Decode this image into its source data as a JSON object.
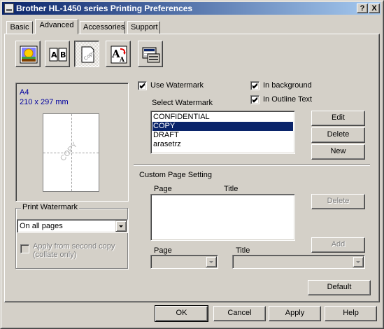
{
  "window": {
    "title": "Brother HL-1450 series Printing Preferences",
    "help_button": "?",
    "close_button": "X"
  },
  "tabs": [
    {
      "label": "Basic",
      "active": false
    },
    {
      "label": "Advanced",
      "active": true
    },
    {
      "label": "Accessories",
      "active": false
    },
    {
      "label": "Support",
      "active": false
    }
  ],
  "toolbar": {
    "icons": [
      "print-quality-icon",
      "duplex-icon",
      "watermark-icon",
      "page-setting-icon",
      "device-options-icon"
    ],
    "pressed_index": 2
  },
  "preview": {
    "paper_size": "A4",
    "dimensions": "210 x 297 mm",
    "watermark_text": "COPY"
  },
  "print_watermark": {
    "group_label": "Print Watermark",
    "selected": "On all pages",
    "apply_from_second": "Apply from second copy\n(collate only)"
  },
  "watermark": {
    "use_watermark_label": "Use Watermark",
    "use_watermark_checked": true,
    "in_background_label": "In background",
    "in_background_checked": true,
    "in_outline_label": "In Outline Text",
    "in_outline_checked": true,
    "select_label": "Select Watermark",
    "items": [
      "CONFIDENTIAL",
      "COPY",
      "DRAFT",
      "arasetrz"
    ],
    "selected_index": 1,
    "edit_button": "Edit",
    "delete_button": "Delete",
    "new_button": "New"
  },
  "custom_page": {
    "section_label": "Custom Page Setting",
    "page_header": "Page",
    "title_header": "Title",
    "delete_button": "Delete",
    "add_button": "Add",
    "page_label": "Page",
    "title_label": "Title"
  },
  "buttons": {
    "default": "Default",
    "ok": "OK",
    "cancel": "Cancel",
    "apply": "Apply",
    "help": "Help"
  },
  "colors": {
    "face": "#d4d0c8",
    "selection": "#0a246a",
    "title_start": "#0a246a",
    "title_end": "#a6caf0",
    "preview_text": "#0000a0"
  }
}
